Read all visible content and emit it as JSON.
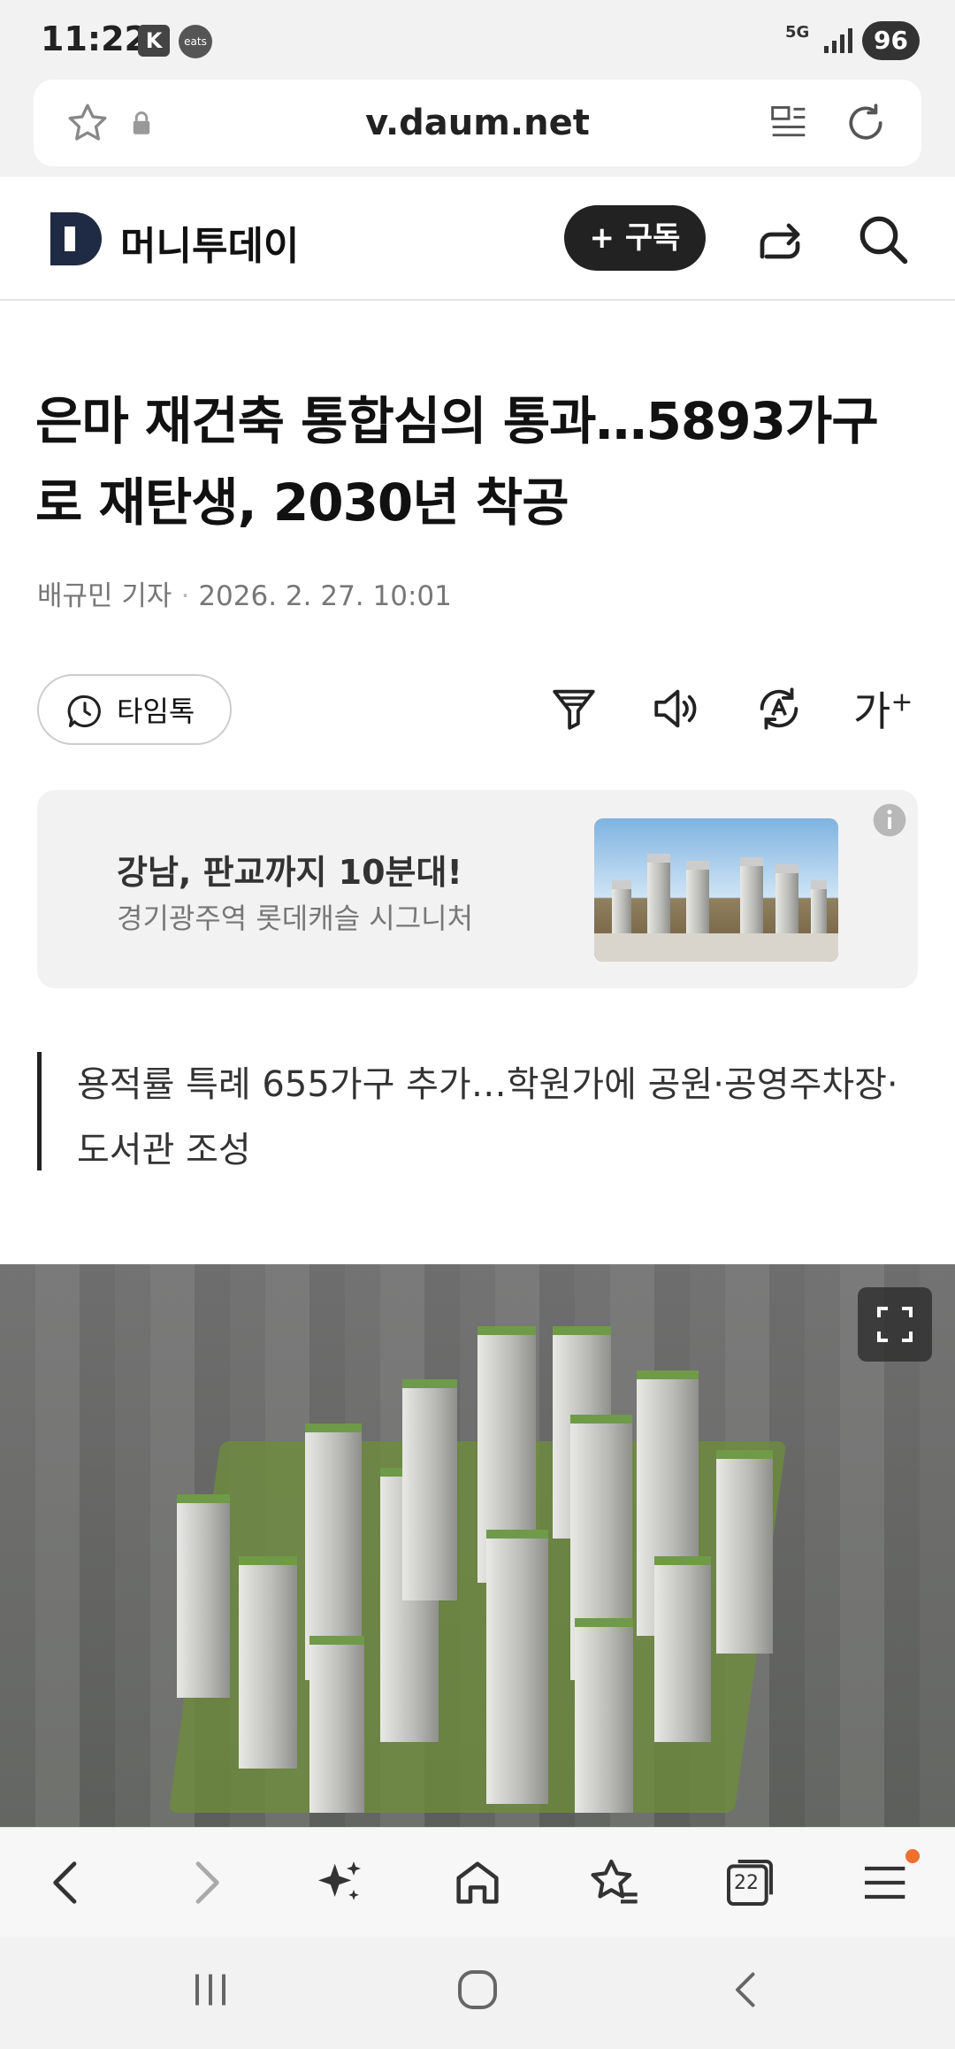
{
  "status_bar": {
    "time": "11:22",
    "app_icons": [
      "K",
      "eats"
    ],
    "network": "5G",
    "battery": "96"
  },
  "browser": {
    "url": "v.daum.net",
    "icons": [
      "star-icon",
      "lock-icon",
      "reader-mode-icon",
      "reload-icon"
    ]
  },
  "site_header": {
    "logo_letter": "D",
    "site_name": "머니투데이",
    "subscribe_label": "+ 구독"
  },
  "article": {
    "headline": "은마 재건축 통합심의 통과…5893가구로 재탄생, 2030년 착공",
    "author": "배규민 기자",
    "date": "2026. 2. 27. 10:01",
    "timetalk_label": "타임톡",
    "fontsize_label": "가",
    "summary": "용적률 특례 655가구 추가…학원가에 공원·공영주차장·도서관 조성"
  },
  "ad": {
    "title": "강남, 판교까지 10분대!",
    "subtitle": "경기광주역 롯데캐슬 시그니처"
  },
  "bottom_nav": {
    "tabs_count": "22"
  },
  "colors": {
    "accent_dark": "#222222",
    "logo": "#1f2a44",
    "notification_dot": "#f07030"
  }
}
